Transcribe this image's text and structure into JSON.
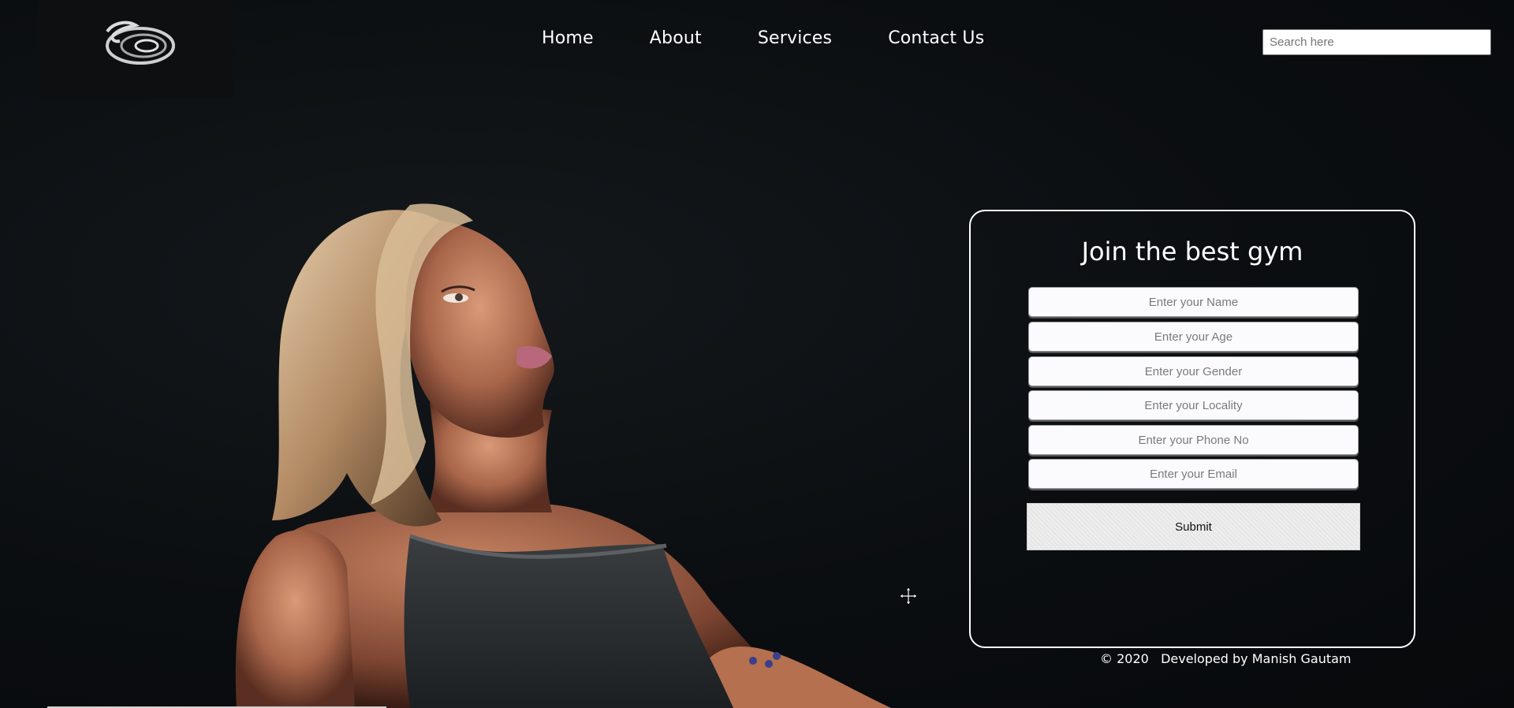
{
  "nav": {
    "home": "Home",
    "about": "About",
    "services": "Services",
    "contact": "Contact Us"
  },
  "search": {
    "placeholder": "Search here"
  },
  "form": {
    "title": "Join the best gym",
    "fields": [
      {
        "placeholder": "Enter your Name"
      },
      {
        "placeholder": "Enter your Age"
      },
      {
        "placeholder": "Enter your Gender"
      },
      {
        "placeholder": "Enter your Locality"
      },
      {
        "placeholder": "Enter your Phone No"
      },
      {
        "placeholder": "Enter your Email"
      }
    ],
    "submit_label": "Submit"
  },
  "footer": {
    "text": "© 2020   Developed by Manish Gautam"
  },
  "colors": {
    "background": "#0a0d10",
    "text": "#ffffff",
    "card_border": "#ffffff"
  },
  "icons": {
    "logo": "gym-logo-icon",
    "cursor": "move-cursor-icon"
  }
}
